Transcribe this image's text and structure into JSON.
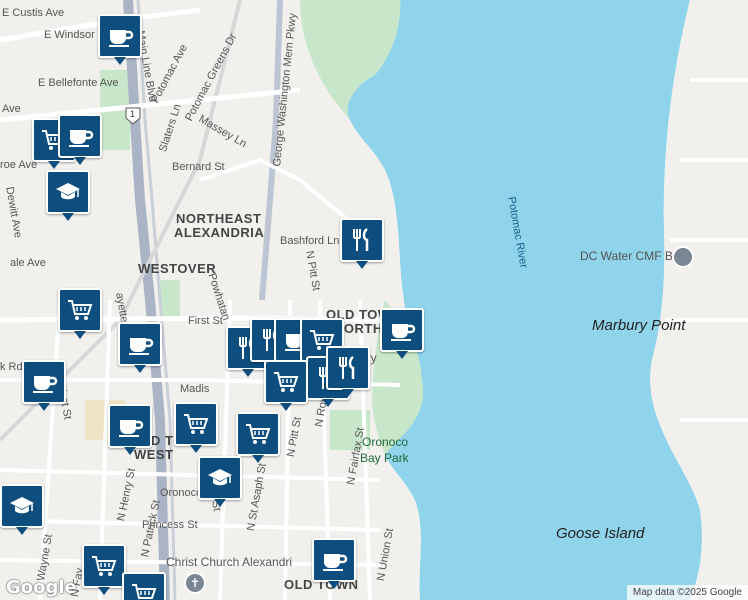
{
  "map": {
    "attribution": "Map data ©2025 Google",
    "logo": "Google",
    "route_shield": "1"
  },
  "labels": {
    "neighborhoods": [
      "NORTHEAST",
      "ALEXANDRIA",
      "WESTOVER",
      "OLD TOWN",
      "NORTH",
      "OLD TOWN",
      "WEST",
      "OLD TOWN"
    ],
    "streets": [
      "E Custis Ave",
      "E Windsor",
      "Main Line Blvd",
      "Potomac Ave",
      "Potomac Greens Dr",
      "E Bellefonte Ave",
      "Ave",
      "Massey Ln",
      "George Washington Mem Pkwy",
      "Slaters Ln",
      "Bernard St",
      "Dewitt Ave",
      "roe Ave",
      "Bashford Ln",
      "ale Ave",
      "N Pitt St",
      "Powhatan",
      "ayette St",
      "First St",
      "N West St",
      "k Rd",
      "Madis",
      "N Royal St",
      "N Fairfax St",
      "N Henry St",
      "N Patrick St",
      "Oronoco St",
      "N St Asaph St",
      "Princess St",
      "N Pitt St",
      "N Union St",
      "Wayne St",
      "N Fay",
      "St"
    ],
    "water": "Potomac River",
    "places": [
      "Marbury Point",
      "Goose Island"
    ],
    "parks": [
      "Oronoco",
      "Bay Park"
    ],
    "pois": [
      "DC Water CMF Bld",
      "Christ Church Alexandri",
      "ery"
    ]
  },
  "markers": [
    {
      "type": "coffee"
    },
    {
      "type": "shopping"
    },
    {
      "type": "coffee"
    },
    {
      "type": "school"
    },
    {
      "type": "restaurant"
    },
    {
      "type": "shopping"
    },
    {
      "type": "coffee"
    },
    {
      "type": "coffee"
    },
    {
      "type": "restaurant"
    },
    {
      "type": "restaurant"
    },
    {
      "type": "coffee"
    },
    {
      "type": "shopping"
    },
    {
      "type": "restaurant"
    },
    {
      "type": "restaurant"
    },
    {
      "type": "shopping"
    },
    {
      "type": "shopping"
    },
    {
      "type": "coffee"
    },
    {
      "type": "shopping"
    },
    {
      "type": "school"
    },
    {
      "type": "school"
    },
    {
      "type": "shopping"
    },
    {
      "type": "coffee"
    },
    {
      "type": "shopping"
    },
    {
      "type": "coffee"
    }
  ],
  "icons": {
    "coffee": "coffee-cup-icon",
    "restaurant": "fork-knife-icon",
    "shopping": "shopping-cart-icon",
    "school": "graduation-cap-icon"
  },
  "colors": {
    "water": "#8fd4ea",
    "land": "#f1f0ed",
    "park": "#c8e6c9",
    "marker": "#0d4e7f",
    "highway": "#aab4c4"
  }
}
